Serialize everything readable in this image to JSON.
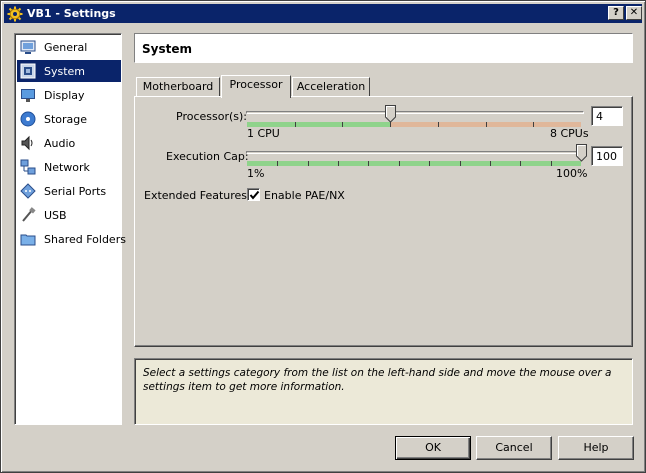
{
  "window": {
    "title": "VB1 - Settings",
    "help_glyph": "?",
    "close_glyph": "✕"
  },
  "sidebar": {
    "items": [
      {
        "label": "General",
        "icon": "monitor-icon"
      },
      {
        "label": "System",
        "icon": "chip-icon"
      },
      {
        "label": "Display",
        "icon": "display-icon"
      },
      {
        "label": "Storage",
        "icon": "disc-icon"
      },
      {
        "label": "Audio",
        "icon": "speaker-icon"
      },
      {
        "label": "Network",
        "icon": "network-icon"
      },
      {
        "label": "Serial Ports",
        "icon": "serial-port-icon"
      },
      {
        "label": "USB",
        "icon": "usb-icon"
      },
      {
        "label": "Shared Folders",
        "icon": "folder-icon"
      }
    ],
    "selected": "System"
  },
  "page_title": "System",
  "tabs": [
    {
      "label": "Motherboard",
      "active": false
    },
    {
      "label": "Processor",
      "active": true
    },
    {
      "label": "Acceleration",
      "active": false
    }
  ],
  "processor": {
    "label": "Processor(s):",
    "min_label": "1 CPU",
    "max_label": "8 CPUs",
    "value": "4",
    "min": 1,
    "max": 8,
    "current": 4,
    "recommended_max": 4
  },
  "execution_cap": {
    "label": "Execution Cap:",
    "min_label": "1%",
    "max_label": "100%",
    "value": "100",
    "min": 1,
    "max": 100,
    "current": 100
  },
  "extended_features": {
    "label": "Extended Features:",
    "checkbox_label": "Enable PAE/NX",
    "checked": true
  },
  "info_text": "Select a settings category from the list on the left-hand side and move the mouse over a settings item to get more information.",
  "buttons": {
    "ok": "OK",
    "cancel": "Cancel",
    "help": "Help"
  },
  "colors": {
    "title_bar": "#0a246a",
    "selection": "#0a246a",
    "slider_ok": "#8fd38b",
    "slider_warn": "#e0b79a",
    "face": "#d4d0c8"
  }
}
